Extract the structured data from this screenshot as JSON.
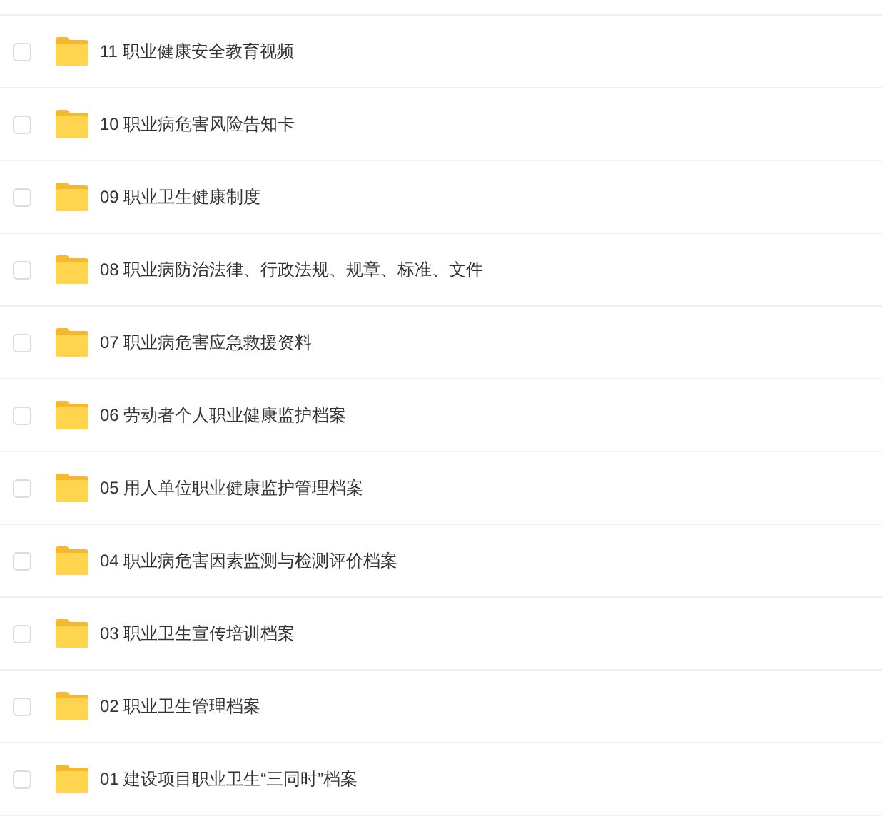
{
  "files": [
    {
      "name": "11 职业健康安全教育视频",
      "checked": false
    },
    {
      "name": "10 职业病危害风险告知卡",
      "checked": false
    },
    {
      "name": "09 职业卫生健康制度",
      "checked": false
    },
    {
      "name": "08 职业病防治法律、行政法规、规章、标准、文件",
      "checked": false
    },
    {
      "name": "07 职业病危害应急救援资料",
      "checked": false
    },
    {
      "name": "06 劳动者个人职业健康监护档案",
      "checked": false
    },
    {
      "name": "05 用人单位职业健康监护管理档案",
      "checked": false
    },
    {
      "name": "04 职业病危害因素监测与检测评价档案",
      "checked": false
    },
    {
      "name": "03 职业卫生宣传培训档案",
      "checked": false
    },
    {
      "name": "02 职业卫生管理档案",
      "checked": false
    },
    {
      "name": "01 建设项目职业卫生“三同时”档案",
      "checked": false
    }
  ]
}
